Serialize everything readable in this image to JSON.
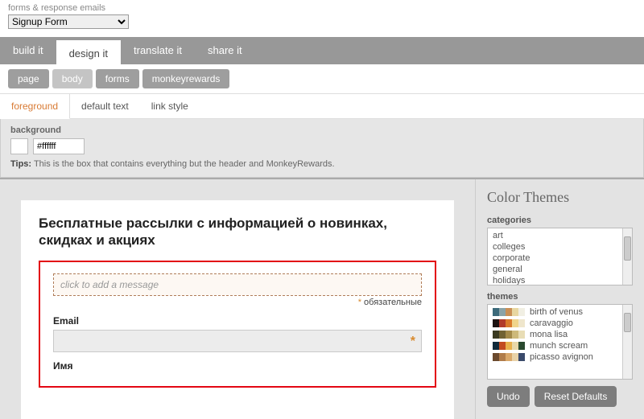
{
  "header": {
    "label": "forms & response emails",
    "selected": "Signup Form"
  },
  "tabs_main": {
    "items": [
      {
        "label": "build it",
        "active": false
      },
      {
        "label": "design it",
        "active": true
      },
      {
        "label": "translate it",
        "active": false
      },
      {
        "label": "share it",
        "active": false
      }
    ]
  },
  "tabs_sub": {
    "items": [
      {
        "label": "page",
        "active": false
      },
      {
        "label": "body",
        "active": true
      },
      {
        "label": "forms",
        "active": false
      },
      {
        "label": "monkeyrewards",
        "active": false
      }
    ]
  },
  "tabs_ter": {
    "items": [
      {
        "label": "foreground",
        "active": true
      },
      {
        "label": "default text",
        "active": false
      },
      {
        "label": "link style",
        "active": false
      }
    ]
  },
  "panel": {
    "bg_label": "background",
    "bg_value": "#ffffff",
    "tips_label": "Tips:",
    "tips_text": "This is the box that contains everything but the header and MonkeyRewards."
  },
  "form": {
    "title": "Бесплатные рассылки с информацией о новинках, скидках и акциях",
    "add_message": "click to add a message",
    "required_label": "обязательные",
    "fields": [
      {
        "label": "Email",
        "required": true,
        "value": ""
      },
      {
        "label": "Имя",
        "required": false,
        "value": ""
      }
    ]
  },
  "side": {
    "title": "Color Themes",
    "categories_label": "categories",
    "categories": [
      "art",
      "colleges",
      "corporate",
      "general",
      "holidays"
    ],
    "themes_label": "themes",
    "themes": [
      {
        "name": "birth of venus",
        "colors": [
          "#3c6a7a",
          "#8aa3a8",
          "#c98f55",
          "#e8d7a1",
          "#f1efe3"
        ]
      },
      {
        "name": "caravaggio",
        "colors": [
          "#1c1210",
          "#b13a2a",
          "#d97a2b",
          "#f0d58b",
          "#efe6cc"
        ]
      },
      {
        "name": "mona lisa",
        "colors": [
          "#3b3a20",
          "#716233",
          "#a38a4a",
          "#cdb97a",
          "#e8ddb5"
        ]
      },
      {
        "name": "munch scream",
        "colors": [
          "#102a3a",
          "#c24a1f",
          "#e8b04a",
          "#e8d8a8",
          "#2a4a2f"
        ]
      },
      {
        "name": "picasso avignon",
        "colors": [
          "#6b4a2e",
          "#b07c4a",
          "#d9a86a",
          "#e8d2a8",
          "#3a4a6b"
        ]
      }
    ],
    "undo": "Undo",
    "reset": "Reset Defaults"
  }
}
